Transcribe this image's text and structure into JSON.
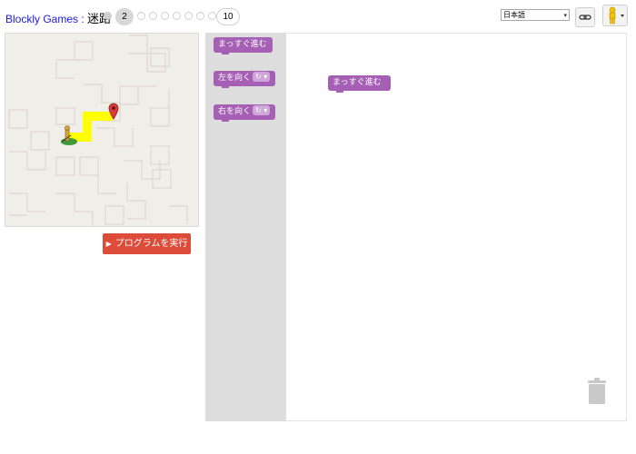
{
  "header": {
    "brand": "Blockly Games",
    "separator": " : ",
    "game": "迷路",
    "levels": [
      "",
      "2",
      "",
      "",
      "",
      "",
      "",
      "",
      "",
      "10"
    ],
    "current_level": 2,
    "language": "日本語"
  },
  "maze": {
    "run_button_label": "プログラムを実行"
  },
  "toolbox": {
    "move_forward": "まっすぐ進む",
    "turn_left": "左を向く",
    "turn_right": "右を向く",
    "turn_symbol": "↻ ▾"
  },
  "workspace": {
    "block_label": "まっすぐ進む"
  },
  "colors": {
    "block": "#a55fb4",
    "run": "#dd4b39",
    "path": "#ffff00"
  }
}
